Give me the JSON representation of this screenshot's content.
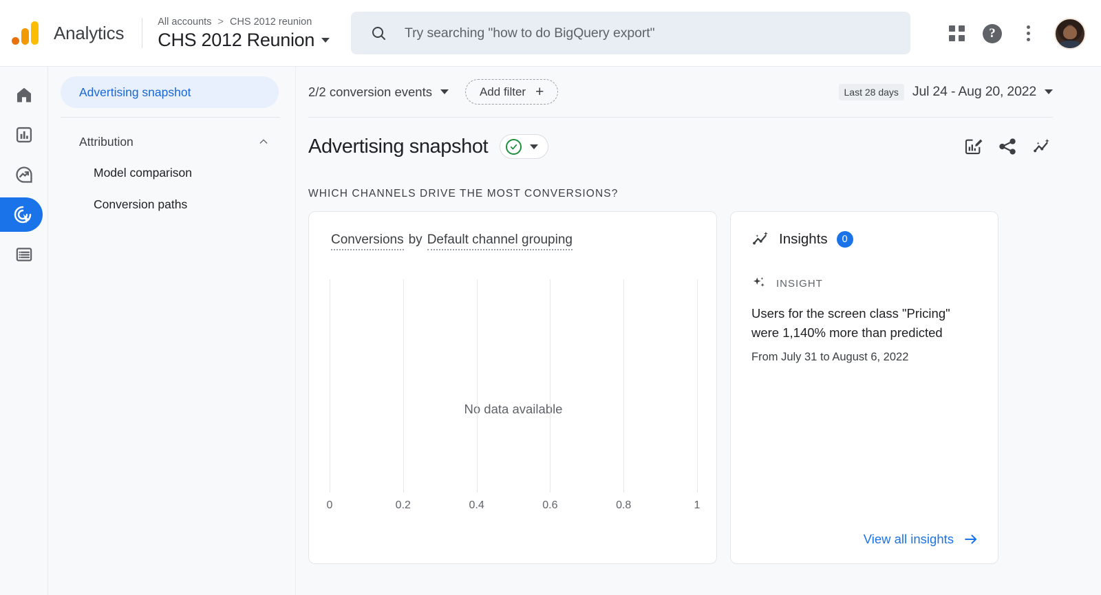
{
  "header": {
    "brand": "Analytics",
    "breadcrumb_root": "All accounts",
    "breadcrumb_sep": ">",
    "breadcrumb_account": "CHS 2012 reunion",
    "property_title": "CHS 2012 Reunion",
    "search_placeholder": "Try searching \"how to do BigQuery export\"",
    "icons": {
      "search": "search-icon",
      "apps": "apps-grid-icon",
      "help": "help-icon",
      "more": "more-vertical-icon",
      "avatar": "user-avatar"
    }
  },
  "rail": {
    "items": [
      {
        "name": "home",
        "label": "Home",
        "active": false
      },
      {
        "name": "reports",
        "label": "Reports",
        "active": false
      },
      {
        "name": "explore",
        "label": "Explore",
        "active": false
      },
      {
        "name": "advertising",
        "label": "Advertising",
        "active": true
      },
      {
        "name": "configure",
        "label": "Configure",
        "active": false
      }
    ]
  },
  "sidebar": {
    "snapshot_label": "Advertising snapshot",
    "group_label": "Attribution",
    "children": [
      {
        "label": "Model comparison"
      },
      {
        "label": "Conversion paths"
      }
    ]
  },
  "toolbar": {
    "conversion_events": "2/2 conversion events",
    "add_filter": "Add filter",
    "add_filter_plus": "+",
    "date_badge": "Last 28 days",
    "date_range": "Jul 24 - Aug 20, 2022"
  },
  "page": {
    "title": "Advertising snapshot",
    "section_heading": "WHICH CHANNELS DRIVE THE MOST CONVERSIONS?"
  },
  "chart_card": {
    "title_metric": "Conversions",
    "title_by": "by",
    "title_dimension": "Default channel grouping"
  },
  "insights": {
    "title": "Insights",
    "count": "0",
    "kicker": "INSIGHT",
    "body_line1": "Users for the screen class \"Pricing\"",
    "body_line2": "were 1,140% more than predicted",
    "subtext": "From July 31 to August 6, 2022",
    "view_all": "View all insights",
    "body_underlined_1": "Users",
    "body_underlined_2": "screen class"
  },
  "chart_data": {
    "type": "bar",
    "title": "Conversions by Default channel grouping",
    "orientation": "horizontal",
    "categories": [],
    "values": [],
    "empty_message": "No data available",
    "xlabel": "",
    "ylabel": "",
    "xlim": [
      0,
      1
    ],
    "xticks": [
      "0",
      "0.2",
      "0.4",
      "0.6",
      "0.8",
      "1"
    ],
    "grid": true,
    "legend": false
  },
  "colors": {
    "accent_blue": "#1a73e8",
    "light_blue_pill": "#e8f0fe",
    "green_check": "#1e8e3e",
    "page_bg": "#f8f9fa",
    "logo_orange": "#f29900",
    "logo_yellow": "#fbbc04"
  }
}
